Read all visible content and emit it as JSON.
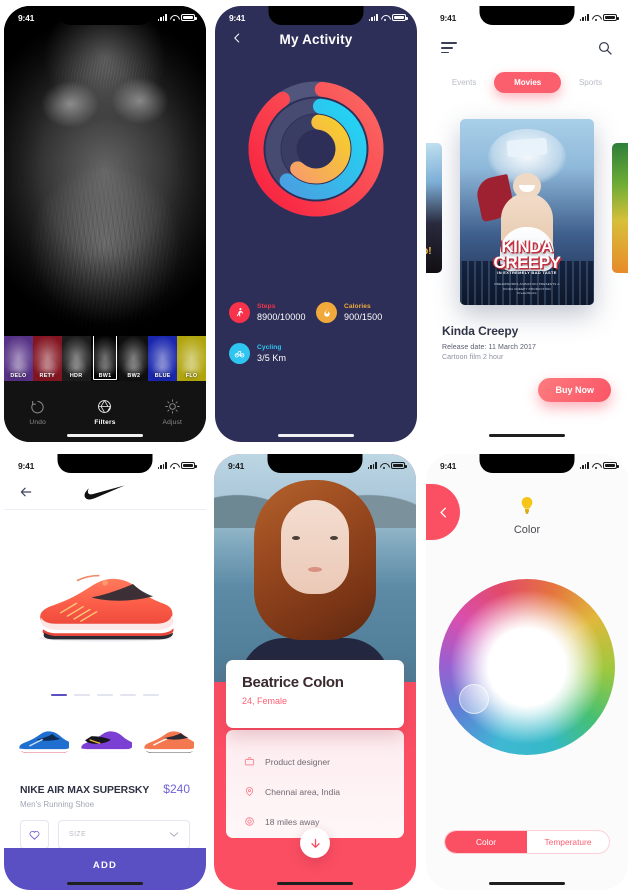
{
  "meta": {
    "accent_red": "#fb5064",
    "accent_purple": "#5b4fc4",
    "dark_navy": "#2e2f58"
  },
  "status_bar": {
    "time": "9:41",
    "signal_icon": "cellular-bars-icon",
    "wifi_icon": "wifi-icon",
    "battery_icon": "battery-icon"
  },
  "panels": [
    {
      "id": "photo-filter-editor",
      "filters": [
        {
          "label": "DELO",
          "tint": "#8a4fd6"
        },
        {
          "label": "RETY",
          "tint": "#d32234"
        },
        {
          "label": "HDR",
          "tint": "#6e6e6e"
        },
        {
          "label": "BW1",
          "tint": "#000000"
        },
        {
          "label": "BW2",
          "tint": "#4a4a4a"
        },
        {
          "label": "BLUE",
          "tint": "#1f2fd8"
        },
        {
          "label": "FLO",
          "tint": "#e2d410"
        }
      ],
      "selected_filter": "BW1",
      "tools": [
        {
          "label": "Undo",
          "icon": "undo-arrow-icon",
          "active": false
        },
        {
          "label": "Filters",
          "icon": "aperture-icon",
          "active": true
        },
        {
          "label": "Adjust",
          "icon": "brightness-icon",
          "active": false
        }
      ]
    },
    {
      "id": "my-activity",
      "title": "My Activity",
      "back_icon": "chevron-left-icon",
      "rings": [
        {
          "name": "Steps",
          "color": "#f8324a",
          "percent": 89
        },
        {
          "name": "Cycling",
          "color": "#2ec5f0",
          "percent": 60
        },
        {
          "name": "Calories",
          "color": "#f5c02e",
          "percent": 60
        }
      ],
      "stats": [
        {
          "key": "Steps",
          "value": "8900/10000",
          "color": "#f8324a",
          "icon": "running-icon",
          "bg": "#f8324a"
        },
        {
          "key": "Calories",
          "value": "900/1500",
          "color": "#f0a93a",
          "icon": "flame-icon",
          "bg": "#f2a93c"
        },
        {
          "key": "Cycling",
          "value": "3/5 Km",
          "color": "#2ec5f0",
          "icon": "bicycle-icon",
          "bg": "#2ec5f0"
        }
      ]
    },
    {
      "id": "movies-browser",
      "menu_icon": "hamburger-menu-icon",
      "search_icon": "search-icon",
      "tabs": [
        {
          "label": "Events",
          "active": false
        },
        {
          "label": "Movies",
          "active": true
        },
        {
          "label": "Sports",
          "active": false
        }
      ],
      "poster": {
        "title_line1": "KINDA",
        "title_line2": "CREEPY",
        "tagline": "IN EXTREMELY BAD TASTE",
        "credits": "DREAMWORKS ANIMATION PRESENTS\nA KINDA CREEPY PRODUCTION\nDreamWorks"
      },
      "movie": {
        "name": "Kinda Creepy",
        "release": "Release date: 11 March 2017",
        "genre": "Cartoon film 2 hour"
      },
      "buy_label": "Buy Now"
    },
    {
      "id": "nike-product",
      "back_icon": "arrow-left-icon",
      "logo_icon": "nike-swoosh-icon",
      "carousel_dots": 5,
      "active_dot": 1,
      "thumbnails": [
        "blue-shoe",
        "purple-shoe",
        "orange-shoe"
      ],
      "product": {
        "name": "NIKE AIR MAX SUPERSKY",
        "price": "$240",
        "subtitle": "Men's Running Shoe"
      },
      "favorite_icon": "heart-icon",
      "size_placeholder": "SIZE",
      "chevron_icon": "chevron-down-icon",
      "add_label": "ADD"
    },
    {
      "id": "profile-card",
      "name": "Beatrice Colon",
      "age_gender": "24, Female",
      "details": [
        {
          "icon": "briefcase-icon",
          "text": "Product designer"
        },
        {
          "icon": "location-pin-icon",
          "text": "Chennai area, India"
        },
        {
          "icon": "radar-icon",
          "text": "18 miles away"
        }
      ],
      "fab_icon": "arrow-down-icon"
    },
    {
      "id": "color-picker",
      "back_icon": "chevron-left-icon",
      "bulb_icon": "lightbulb-icon",
      "label": "Color",
      "wheel_icon": "color-wheel",
      "segments": [
        {
          "label": "Color",
          "active": true
        },
        {
          "label": "Temperature",
          "active": false
        }
      ]
    }
  ]
}
